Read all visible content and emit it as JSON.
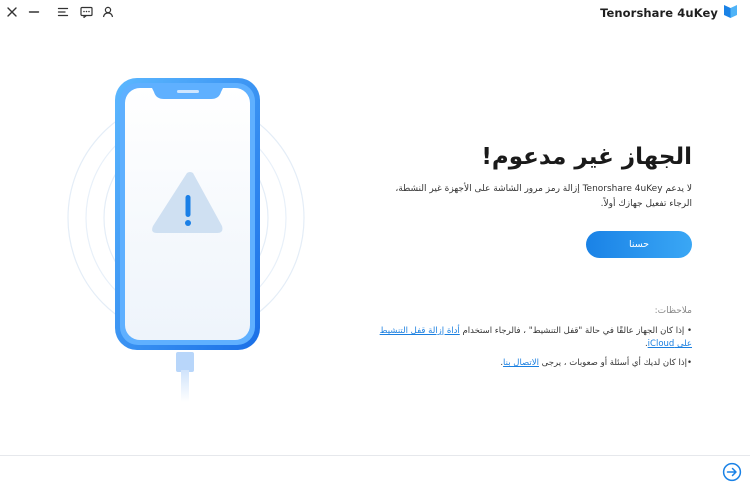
{
  "app": {
    "brand_name": "Tenorshare 4uKey",
    "accent_color": "#1a82e6"
  },
  "titlebar": {
    "icons": [
      "close-icon",
      "minimize-icon",
      "menu-icon",
      "feedback-icon",
      "account-icon"
    ]
  },
  "main": {
    "headline": "الجهاز غير مدعوم!",
    "description": "لا يدعم Tenorshare 4uKey إزالة رمز مرور الشاشة على الأجهزة غير النشطة، الرجاء تفعيل جهازك أولاً.",
    "ok_button": "حسنا"
  },
  "notes": {
    "title": "ملاحظات:",
    "note1_text": "• إذا كان الجهاز عالقًا في حالة \"قفل التنشيط\" ، فالرجاء استخدام ",
    "note1_link": "أداة إزالة قفل التنشيط على iCloud",
    "note1_end": ".",
    "note2_text": "•إذا كان لديك أي أسئلة أو صعوبات ، يرجى ",
    "note2_link": "الاتصال بنا",
    "note2_end": "."
  },
  "footer": {
    "next_icon": "arrow-right-circle-icon"
  }
}
